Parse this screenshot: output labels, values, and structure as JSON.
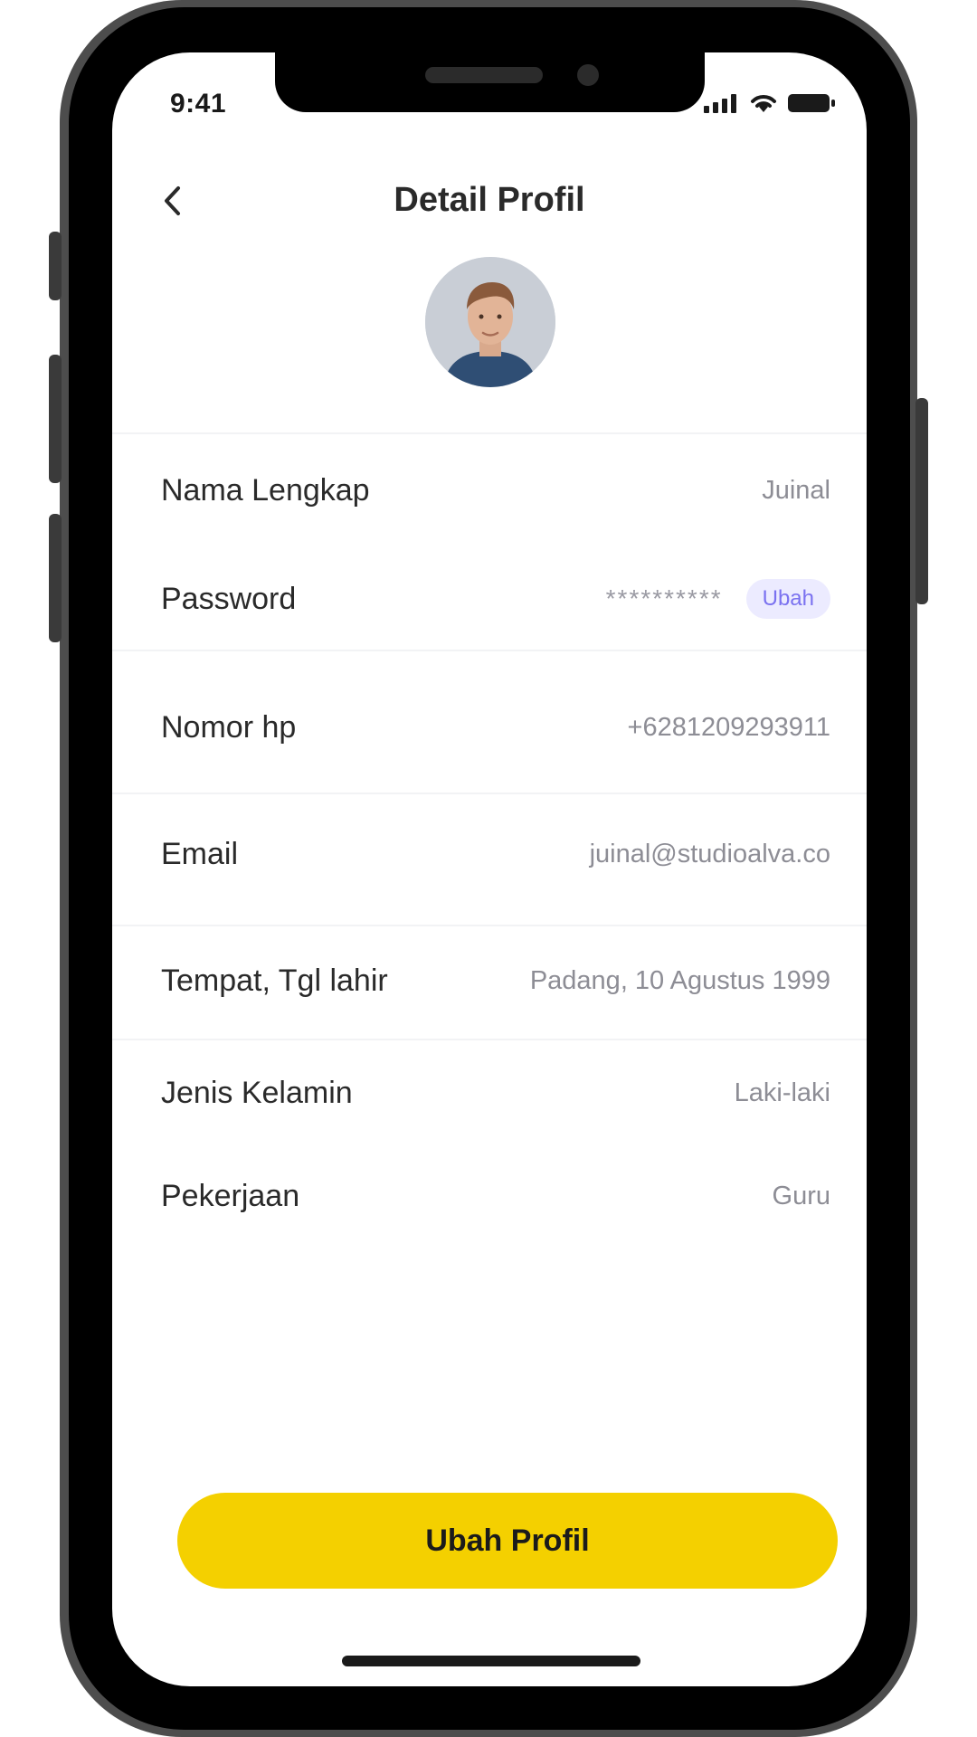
{
  "status_bar": {
    "time": "9:41"
  },
  "header": {
    "title": "Detail Profil",
    "back_icon": "chevron-left-icon"
  },
  "profile": {
    "full_name_label": "Nama Lengkap",
    "full_name_value": "Juinal",
    "password_label": "Password",
    "password_value": "**********",
    "password_action": "Ubah",
    "phone_label": "Nomor hp",
    "phone_value": "+6281209293911",
    "email_label": "Email",
    "email_value": "juinal@studioalva.co",
    "birth_label": "Tempat, Tgl lahir",
    "birth_value": "Padang, 10 Agustus 1999",
    "gender_label": "Jenis Kelamin",
    "gender_value": "Laki-laki",
    "job_label": "Pekerjaan",
    "job_value": "Guru"
  },
  "actions": {
    "edit_profile_label": "Ubah Profil"
  },
  "colors": {
    "accent": "#f4d000",
    "badge_bg": "#ecebff",
    "badge_text": "#7b72f0"
  }
}
